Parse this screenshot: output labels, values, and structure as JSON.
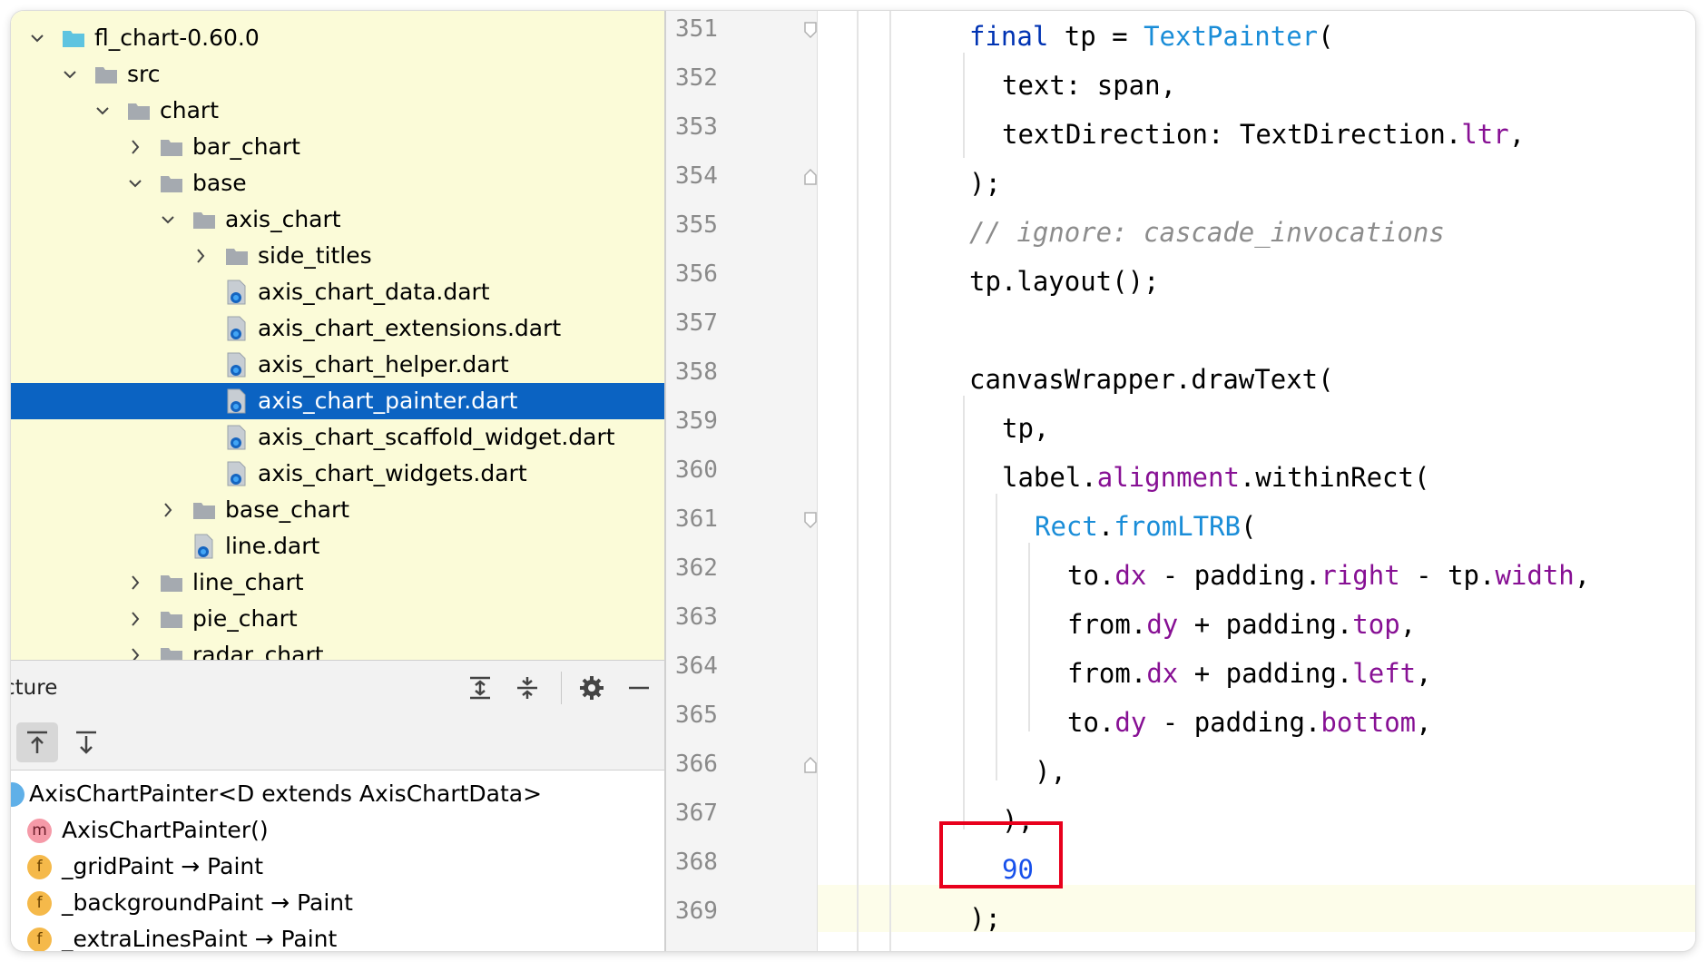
{
  "project_tree": {
    "items": [
      {
        "label": "fl_chart-0.60.0",
        "expanded": true
      },
      {
        "label": "src",
        "expanded": true
      },
      {
        "label": "chart",
        "expanded": true
      },
      {
        "label": "bar_chart",
        "expanded": false
      },
      {
        "label": "base",
        "expanded": true
      },
      {
        "label": "axis_chart",
        "expanded": true
      },
      {
        "label": "side_titles",
        "expanded": false
      },
      {
        "label": "axis_chart_data.dart"
      },
      {
        "label": "axis_chart_extensions.dart"
      },
      {
        "label": "axis_chart_helper.dart"
      },
      {
        "label": "axis_chart_painter.dart",
        "selected": true
      },
      {
        "label": "axis_chart_scaffold_widget.dart"
      },
      {
        "label": "axis_chart_widgets.dart"
      },
      {
        "label": "base_chart",
        "expanded": false
      },
      {
        "label": "line.dart"
      },
      {
        "label": "line_chart",
        "expanded": false
      },
      {
        "label": "pie_chart",
        "expanded": false
      },
      {
        "label": "radar_chart",
        "expanded": false
      }
    ]
  },
  "structure": {
    "title": "cture",
    "items": [
      {
        "kind": "c",
        "label": "AxisChartPainter<D extends AxisChartData>"
      },
      {
        "kind": "m",
        "label": "AxisChartPainter()"
      },
      {
        "kind": "f",
        "label": "_gridPaint → Paint"
      },
      {
        "kind": "f",
        "label": "_backgroundPaint → Paint"
      },
      {
        "kind": "f",
        "label": "_extraLinesPaint → Paint"
      }
    ],
    "badges": {
      "m": "m",
      "f": "f"
    }
  },
  "editor": {
    "line_numbers": [
      "351",
      "352",
      "353",
      "354",
      "355",
      "356",
      "357",
      "358",
      "359",
      "360",
      "361",
      "362",
      "363",
      "364",
      "365",
      "366",
      "367",
      "368",
      "369"
    ],
    "code": {
      "l351": {
        "kw": "final",
        "a": " tp = ",
        "ty": "TextPainter",
        "b": "("
      },
      "l352": "text: span,",
      "l353": {
        "a": "textDirection: TextDirection.",
        "pr": "ltr",
        "b": ","
      },
      "l354": ");",
      "l355": "// ignore: cascade_invocations",
      "l356": "tp.layout();",
      "l358": "canvasWrapper.drawText(",
      "l359": "tp,",
      "l360": {
        "a": "label.",
        "pr": "alignment",
        "b": ".withinRect("
      },
      "l361": {
        "ty1": "Rect",
        "a": ".",
        "ty2": "fromLTRB",
        "b": "("
      },
      "l362": {
        "a": "to.",
        "pr1": "dx",
        "b": " - padding.",
        "pr2": "right",
        "c": " - tp.",
        "pr3": "width",
        "d": ","
      },
      "l363": {
        "a": "from.",
        "pr1": "dy",
        "b": " + padding.",
        "pr2": "top",
        "c": ","
      },
      "l364": {
        "a": "from.",
        "pr1": "dx",
        "b": " + padding.",
        "pr2": "left",
        "c": ","
      },
      "l365": {
        "a": "to.",
        "pr1": "dy",
        "b": " - padding.",
        "pr2": "bottom",
        "c": ","
      },
      "l366": "),",
      "l367": "),",
      "l368": "90",
      "l369": ");"
    }
  }
}
